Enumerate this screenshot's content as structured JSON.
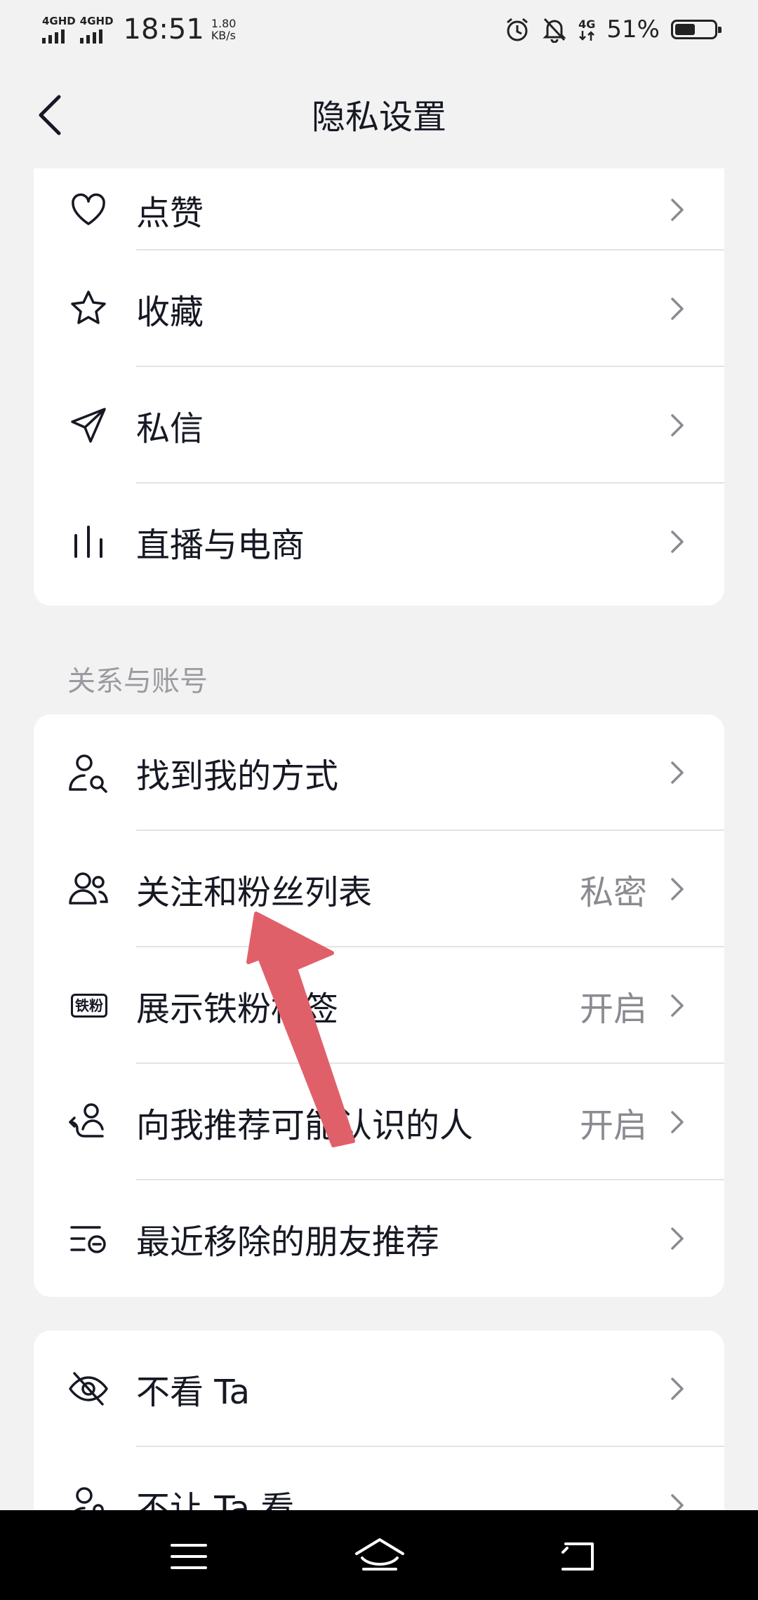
{
  "status_bar": {
    "network_1": "4GHD",
    "network_2": "4GHD",
    "time": "18:51",
    "speed_value": "1.80",
    "speed_unit": "KB/s",
    "network_small": "4G",
    "battery_percent": "51%",
    "battery_level": 0.51
  },
  "header": {
    "title": "隐私设置",
    "back_icon": "chevron-left-icon"
  },
  "card_interaction": {
    "items": [
      {
        "icon": "heart-icon",
        "label": "点赞",
        "value": ""
      },
      {
        "icon": "star-icon",
        "label": "收藏",
        "value": ""
      },
      {
        "icon": "paper-plane-icon",
        "label": "私信",
        "value": ""
      },
      {
        "icon": "bars-icon",
        "label": "直播与电商",
        "value": ""
      }
    ]
  },
  "section_relations": {
    "title": "关系与账号"
  },
  "card_relations": {
    "items": [
      {
        "icon": "user-search-icon",
        "label": "找到我的方式",
        "value": ""
      },
      {
        "icon": "users-icon",
        "label": "关注和粉丝列表",
        "value": "私密"
      },
      {
        "icon": "badge-icon",
        "badge_text": "铁粉",
        "label": "展示铁粉标签",
        "value": "开启"
      },
      {
        "icon": "recommend-user-icon",
        "label": "向我推荐可能认识的人",
        "value": "开启"
      },
      {
        "icon": "list-remove-icon",
        "label": "最近移除的朋友推荐",
        "value": ""
      }
    ]
  },
  "card_block": {
    "items": [
      {
        "icon": "eye-off-icon",
        "label": "不看 Ta",
        "value": ""
      },
      {
        "icon": "user-lock-icon",
        "label": "不让 Ta 看",
        "value": ""
      }
    ]
  },
  "annotation": {
    "color": "#e0606a",
    "target": "关注和粉丝列表"
  },
  "system_nav": {
    "icons": [
      "menu-icon",
      "home-icon",
      "back-return-icon"
    ]
  }
}
